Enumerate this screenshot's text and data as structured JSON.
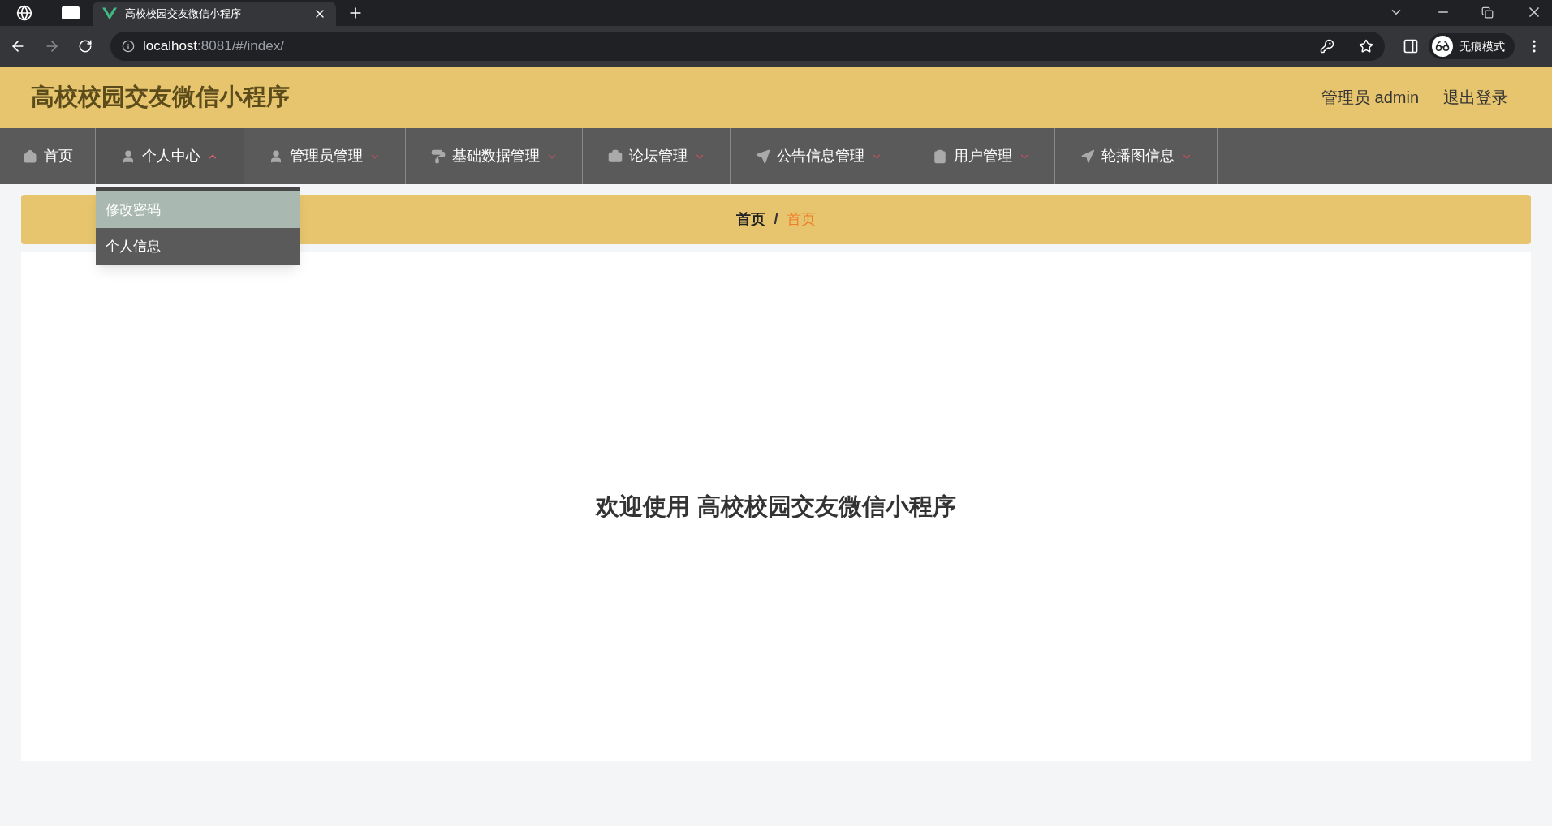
{
  "browser": {
    "tabs": [
      {
        "title": "高校校园交友微信小程序",
        "selected": true
      }
    ],
    "url": {
      "host": "localhost",
      "path": ":8081/#/index/"
    },
    "profile_label": "无痕模式"
  },
  "header": {
    "title": "高校校园交友微信小程序",
    "user": "管理员 admin",
    "logout": "退出登录"
  },
  "nav": [
    {
      "label": "首页",
      "kind": "link"
    },
    {
      "label": "个人中心",
      "kind": "menu",
      "expanded": true,
      "menu": [
        {
          "label": "修改密码",
          "selected": true
        },
        {
          "label": "个人信息",
          "selected": false
        }
      ]
    },
    {
      "label": "管理员管理",
      "kind": "menu",
      "expanded": false
    },
    {
      "label": "基础数据管理",
      "kind": "menu",
      "expanded": false
    },
    {
      "label": "论坛管理",
      "kind": "menu",
      "expanded": false
    },
    {
      "label": "公告信息管理",
      "kind": "menu",
      "expanded": false
    },
    {
      "label": "用户管理",
      "kind": "menu",
      "expanded": false
    },
    {
      "label": "轮播图信息",
      "kind": "menu",
      "expanded": false
    }
  ],
  "breadcrumb_separator": "/",
  "breadcrumb": [
    {
      "label": "首页",
      "current": false
    },
    {
      "label": "首页",
      "current": true
    }
  ],
  "welcome": "欢迎使用 高校校园交友微信小程序"
}
